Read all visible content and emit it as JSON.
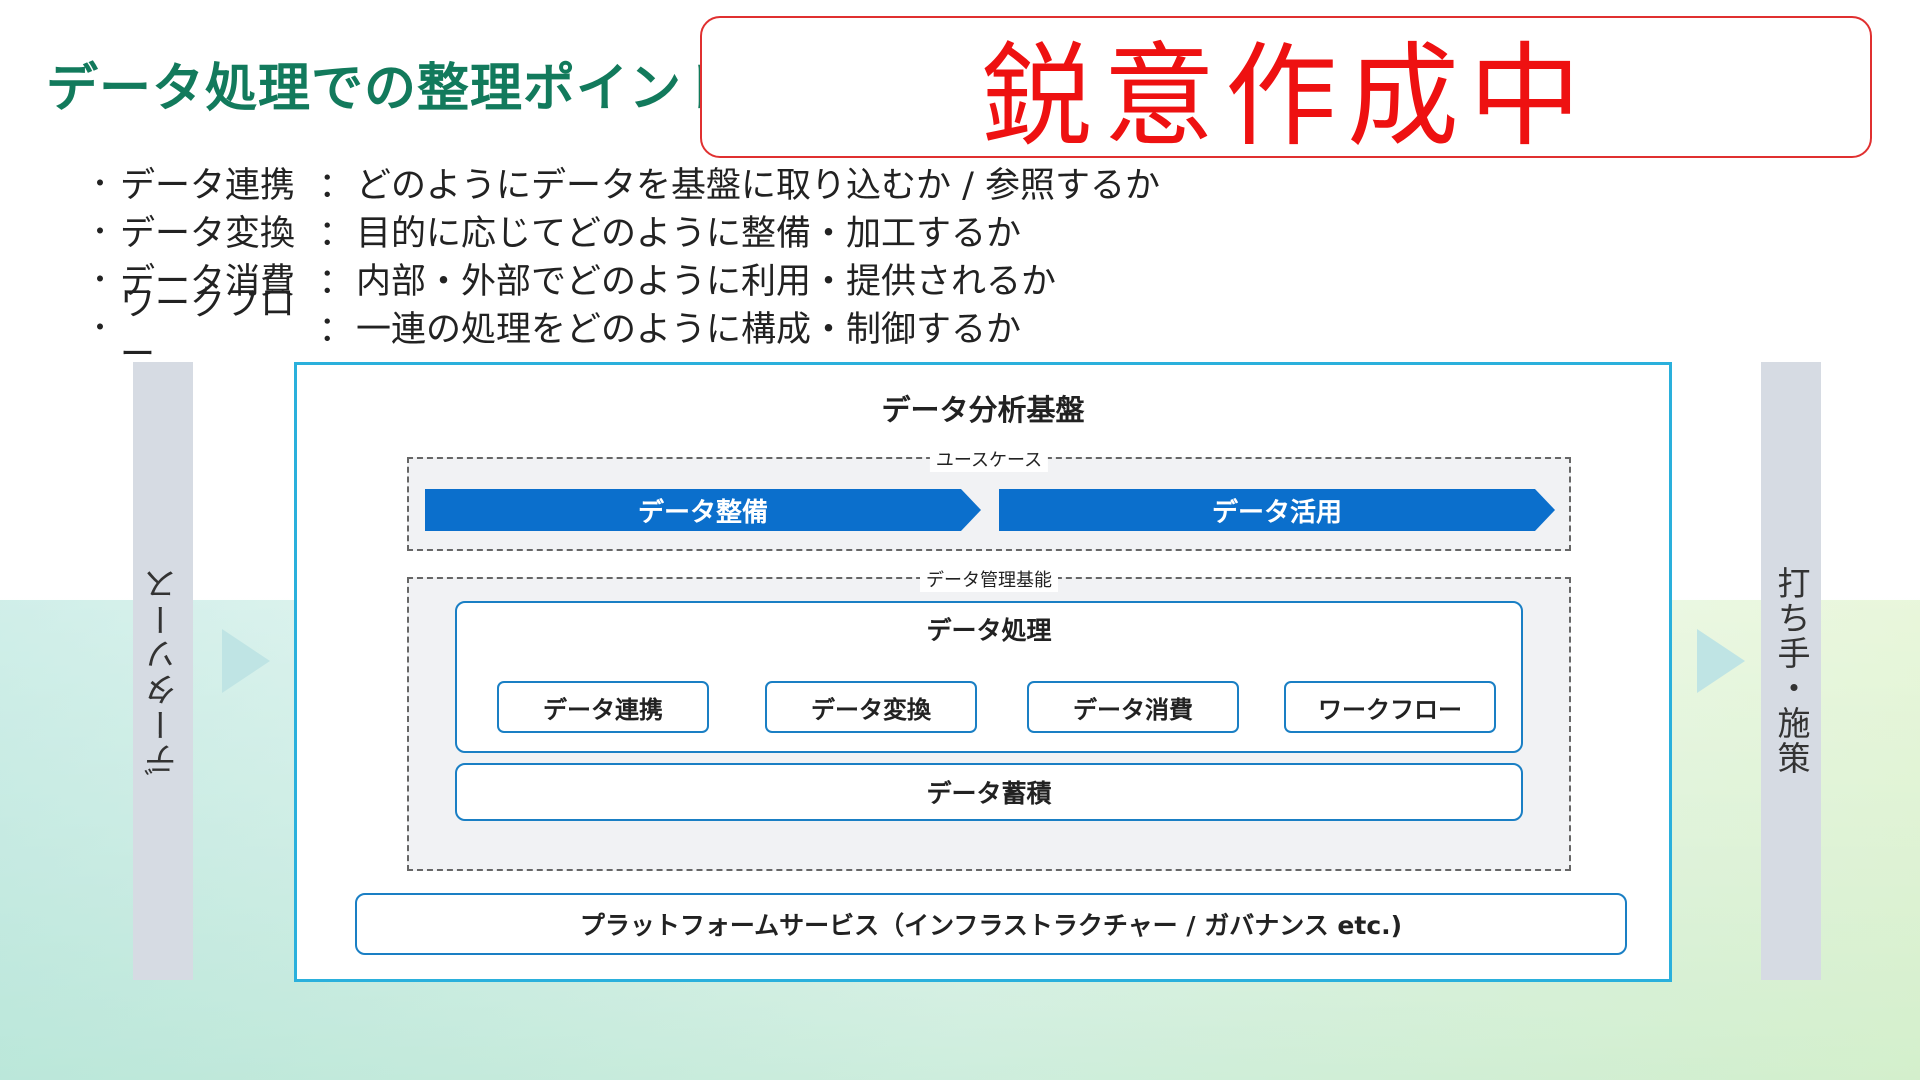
{
  "title": "データ処理での整理ポイント",
  "stamp": "鋭意作成中",
  "bullets": [
    {
      "term": "データ連携",
      "desc": "どのようにデータを基盤に取り込むか / 参照するか"
    },
    {
      "term": "データ変換",
      "desc": "目的に応じてどのように整備・加工するか"
    },
    {
      "term": "データ消費",
      "desc": "内部・外部でどのように利用・提供されるか"
    },
    {
      "term": "ワークフロー",
      "desc": "一連の処理をどのように構成・制御するか"
    }
  ],
  "bullet_marker": "・",
  "bullet_separator": "：",
  "diagram": {
    "left_label": "データソース",
    "right_label": "打ち手・施策",
    "frame_title": "データ分析基盤",
    "usecase": {
      "label": "ユースケース",
      "arrows": [
        "データ整備",
        "データ活用"
      ]
    },
    "management": {
      "label": "データ管理基能",
      "processing": {
        "title": "データ処理",
        "items": [
          "データ連携",
          "データ変換",
          "データ消費",
          "ワークフロー"
        ]
      },
      "storage": "データ蓄積"
    },
    "platform_services": "プラットフォームサービス（インフラストラクチャー / ガバナンス etc.)"
  },
  "colors": {
    "title": "#127a5c",
    "stamp_text": "#ee1111",
    "frame_border": "#2ab0dc",
    "arrow_fill": "#0b6fcc",
    "box_border": "#1a7fc4",
    "side_bar": "#d6dbe3"
  }
}
